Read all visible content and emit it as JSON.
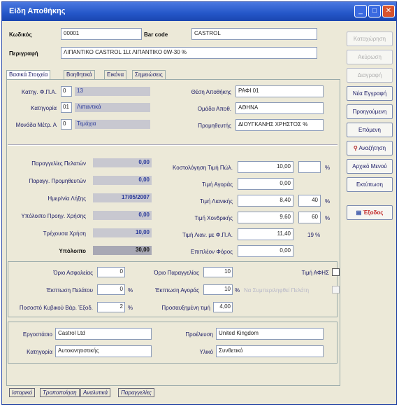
{
  "window": {
    "title": "Είδη Αποθήκης",
    "minimize_glyph": "_",
    "maximize_glyph": "□",
    "close_glyph": "✕"
  },
  "header": {
    "code_label": "Κωδικός",
    "code_value": "00001",
    "barcode_label": "Bar code",
    "barcode_value": "CASTROL",
    "desc_label": "Περιγραφή",
    "desc_value": "ΛΙΠΑΝΤΙΚΟ CASTROL 1Lt ΛΙΠΑΝΤΙΚΟ 0W-30 %"
  },
  "tabs": [
    "Βασικά Στοιχεία",
    "Βοηθητικά",
    "Εικόνα",
    "Σημειώσεις"
  ],
  "basic": {
    "vat_label": "Κατηγ. Φ.Π.Α.",
    "vat_code": "0",
    "vat_value": "13",
    "category_label": "Κατηγορία",
    "category_code": "01",
    "category_value": "Λιπαντικά",
    "unit_label": "Μονάδα Μέτρ. Α",
    "unit_code": "0",
    "unit_value": "Τεμάχια",
    "storage_label": "Θέση Αποθήκης",
    "storage_value": "ΡΑΦΙ 01",
    "group_label": "Ομάδα Αποθ.",
    "group_value": "ΑΘΗΝΑ",
    "supplier_label": "Προμηθευτής",
    "supplier_value": "ΔΙΟΥΓΚΑΝΗΣ ΧΡΗΣΤΟΣ %"
  },
  "stats": {
    "rows_left": [
      {
        "label": "Παραγγελίες Πελατών",
        "value": "0,00"
      },
      {
        "label": "Παραγγ. Προμηθευτών",
        "value": "0,00"
      },
      {
        "label": "Ημερ/νία Λήξης",
        "value": "17/05/2007"
      },
      {
        "label": "Υπόλοιπο Προηγ. Χρήσης",
        "value": "0,00"
      },
      {
        "label": "Τρέχουσα Χρήση",
        "value": "10,00"
      },
      {
        "label": "Υπόλοιπο",
        "value": "30,00"
      }
    ],
    "rows_right": [
      {
        "label": "Κοστολόγηση Τιμή Πώλ.",
        "value": "10,00",
        "pct": "",
        "unit": "%"
      },
      {
        "label": "Τιμή Αγοράς",
        "value": "0,00",
        "pct": "",
        "unit": ""
      },
      {
        "label": "Τιμή Λιανικής",
        "value": "8,40",
        "pct": "40",
        "unit": "%"
      },
      {
        "label": "Τιμή Χονδρικής",
        "value": "9,60",
        "pct": "60",
        "unit": "%"
      },
      {
        "label": "Τιμή Λιαν. με Φ.Π.Α.",
        "value": "11,40",
        "pct": "",
        "unit": "19 %"
      },
      {
        "label": "Επιπλέον Φόρος",
        "value": "0,00",
        "pct": "",
        "unit": ""
      }
    ]
  },
  "limits": {
    "min_label": "Όριο Ασφαλείας",
    "min_value": "0",
    "reorder_label": "Όριο Παραγγελίας",
    "reorder_value": "10",
    "no_discount_label": "Τιμή ΑΦΗΣ",
    "disc_client_label": "Έκπτωση Πελάτου",
    "disc_client_value": "0",
    "disc_client_unit": "%",
    "disc_buy_label": "Έκπτωση Αγοράς",
    "disc_buy_value": "10",
    "disc_buy_unit": "%",
    "no_change_label": "Να Συμπεριληφθεί Πελάτη",
    "margin_label": "Ποσοστό Κυβικού Βάρ. Έξοδ.",
    "margin_value": "2",
    "margin_unit": "%",
    "commission_label": "Προσαυξημένη τιμή",
    "commission_value": "4,00"
  },
  "bottom": {
    "brand_label": "Εργοστάσιο",
    "brand_value": "Castrol Ltd",
    "origin_label": "Προέλευση",
    "origin_value": "United Kingdom",
    "category_label": "Κατηγορία",
    "category_value": "Αυτοκινητιστικής",
    "material_label": "Υλικό",
    "material_value": "Συνθετικό"
  },
  "bottom_tabs": [
    "Ιστορικό",
    "Τροποποίηση",
    "Αναλυτικά",
    "Παραγγελίες"
  ],
  "buttons": {
    "b1": "Καταχώρηση",
    "b2": "Ακύρωση",
    "b3": "Διαγραφή",
    "b4": "Νέα Εγγραφή",
    "b5": "Προηγούμενη",
    "b6": "Επόμενη",
    "b7": "Αναζήτηση",
    "b8": "Αρχικό Μενού",
    "b9": "Εκτύπωση",
    "b10": "Έξοδος"
  }
}
